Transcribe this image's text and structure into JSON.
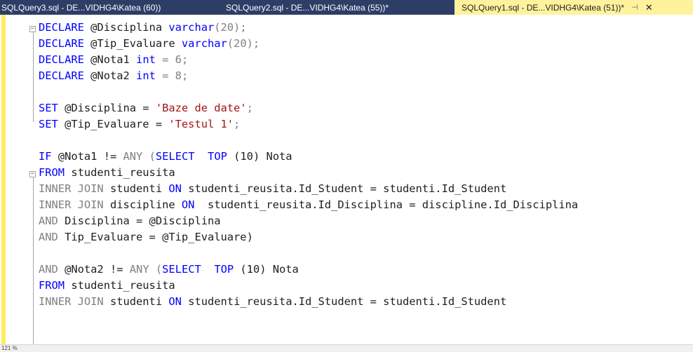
{
  "tabs": [
    {
      "label": "SQLQuery3.sql - DE...VIDHG4\\Katea (60))"
    },
    {
      "label": "SQLQuery2.sql - DE...VIDHG4\\Katea (55))*"
    },
    {
      "label": "SQLQuery1.sql - DE...VIDHG4\\Katea (51))*",
      "pin": "⊣",
      "close": "✕"
    }
  ],
  "code": {
    "l1": [
      "DECLARE",
      "@Disciplina",
      "varchar",
      "(20);"
    ],
    "l2": [
      "DECLARE",
      "@Tip_Evaluare",
      "varchar",
      "(20);"
    ],
    "l3": [
      "DECLARE",
      "@Nota1",
      "int",
      "= 6;"
    ],
    "l4": [
      "DECLARE",
      "@Nota2",
      "int",
      "= 8;"
    ],
    "l6": [
      "SET",
      "@Disciplina =",
      "'Baze de date'",
      ";"
    ],
    "l7": [
      "SET",
      "@Tip_Evaluare =",
      "'Testul 1'",
      ";"
    ],
    "l9": [
      "IF",
      "@Nota1 !=",
      "ANY",
      "(",
      "SELECT",
      "TOP",
      "(10) Nota"
    ],
    "l10": [
      "FROM",
      "studenti_reusita"
    ],
    "l11": [
      "INNER JOIN",
      "studenti",
      "ON",
      "studenti_reusita.Id_Student = studenti.Id_Student"
    ],
    "l12": [
      "INNER JOIN",
      "discipline",
      "ON",
      "studenti_reusita.Id_Disciplina = discipline.Id_Disciplina"
    ],
    "l13": [
      "AND",
      "Disciplina =",
      "@Disciplina"
    ],
    "l14": [
      "AND",
      "Tip_Evaluare =",
      "@Tip_Evaluare)"
    ],
    "l16": [
      "AND",
      "@Nota2 !=",
      "ANY",
      "(",
      "SELECT",
      "TOP",
      "(10) Nota"
    ],
    "l17": [
      "FROM",
      "studenti_reusita"
    ],
    "l18": [
      "INNER JOIN",
      "studenti",
      "ON",
      "studenti_reusita.Id_Student = studenti.Id_Student"
    ]
  },
  "status": {
    "zoom": "121 %"
  },
  "colors": {
    "keyword": "#0000ff",
    "string": "#a31515",
    "operator": "#808080",
    "tab_active": "#fff29d",
    "tab_bar": "#2d3d66"
  }
}
